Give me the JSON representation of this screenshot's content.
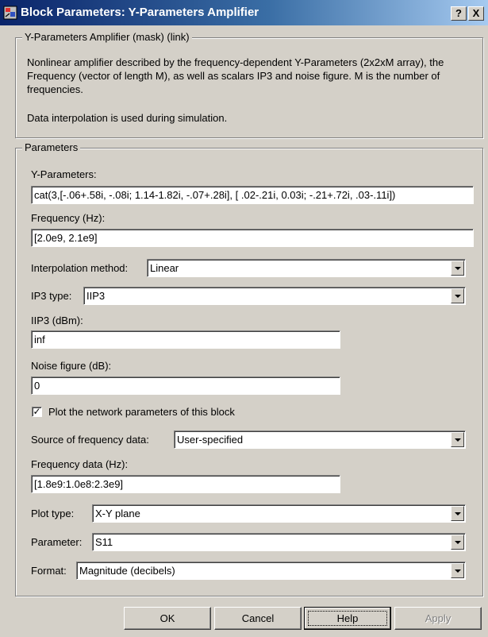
{
  "window": {
    "title": "Block Parameters: Y-Parameters Amplifier",
    "help_glyph": "?",
    "close_glyph": "X"
  },
  "description": {
    "legend": "Y-Parameters Amplifier (mask) (link)",
    "text1": "Nonlinear amplifier described by the frequency-dependent Y-Parameters (2x2xM array), the Frequency (vector of length M), as well as scalars IP3 and noise figure. M is the number of frequencies.",
    "text2": "Data interpolation is used during simulation."
  },
  "parameters": {
    "legend": "Parameters",
    "yparams_label": "Y-Parameters:",
    "yparams_value": "cat(3,[-.06+.58i, -.08i; 1.14-1.82i, -.07+.28i], [ .02-.21i, 0.03i;  -.21+.72i,  .03-.11i])",
    "frequency_label": "Frequency (Hz):",
    "frequency_value": "[2.0e9, 2.1e9]",
    "interp_label": "Interpolation method:",
    "interp_value": "Linear",
    "ip3type_label": "IP3 type:",
    "ip3type_value": "IIP3",
    "iip3_label": "IIP3 (dBm):",
    "iip3_value": "inf",
    "noise_label": "Noise figure (dB):",
    "noise_value": "0",
    "plot_check_label": "Plot the network parameters of this block",
    "plot_checked": true,
    "source_label": "Source of frequency data:",
    "source_value": "User-specified",
    "freqdata_label": "Frequency data (Hz):",
    "freqdata_value": "[1.8e9:1.0e8:2.3e9]",
    "plottype_label": "Plot type:",
    "plottype_value": "X-Y plane",
    "parameter_label": "Parameter:",
    "parameter_value": "S11",
    "format_label": "Format:",
    "format_value": "Magnitude (decibels)"
  },
  "buttons": {
    "ok": "OK",
    "cancel": "Cancel",
    "help": "Help",
    "apply": "Apply"
  },
  "icons": {
    "app": "simulink-block-icon",
    "dropdown": "dropdown-arrow-icon"
  }
}
